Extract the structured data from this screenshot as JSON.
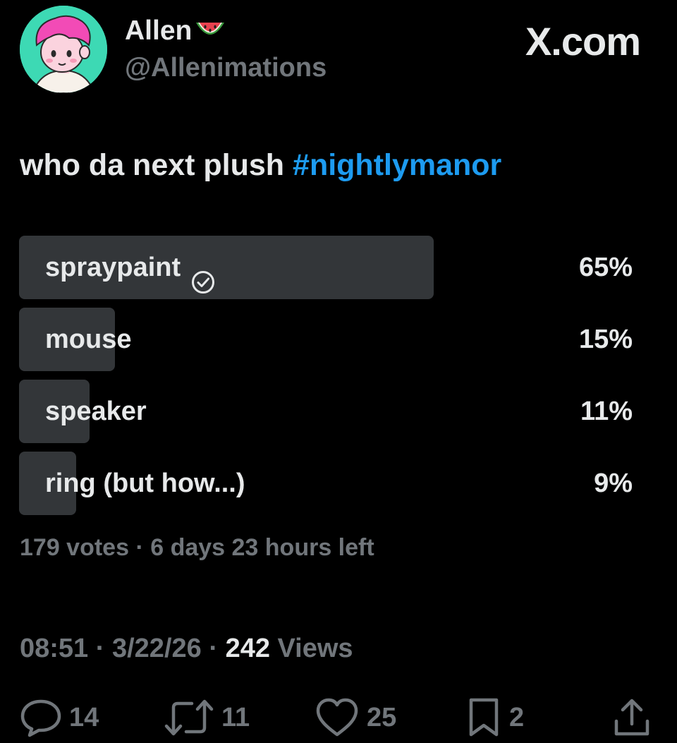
{
  "author": {
    "display_name": "Allen",
    "handle": "@Allenimations"
  },
  "site_label": "X.com",
  "tweet": {
    "text": "who da next plush ",
    "hashtag": "#nightlymanor"
  },
  "poll": {
    "options": [
      {
        "label": "spraypaint",
        "percent_text": "65%",
        "share": 0.65,
        "selected": true
      },
      {
        "label": "mouse",
        "percent_text": "15%",
        "share": 0.15,
        "selected": false
      },
      {
        "label": "speaker",
        "percent_text": "11%",
        "share": 0.11,
        "selected": false
      },
      {
        "label": "ring (but how...)",
        "percent_text": "9%",
        "share": 0.09,
        "selected": false
      }
    ],
    "votes_text": "179 votes",
    "separator": " · ",
    "time_left": "6 days 23 hours left"
  },
  "meta": {
    "time": "08:51",
    "date": "3/22/26",
    "views_count": "242",
    "views_label": " Views",
    "separator": " · "
  },
  "actions": {
    "replies": "14",
    "reposts": "11",
    "likes": "25",
    "bookmarks": "2"
  },
  "icons": {
    "reply": "reply-icon",
    "repost": "repost-icon",
    "like": "heart-icon",
    "bookmark": "bookmark-icon",
    "share": "share-icon",
    "verified_choice": "check-circle-icon",
    "emoji": "watermelon-icon"
  },
  "colors": {
    "background": "#000000",
    "text_primary": "#e7e9ea",
    "text_secondary": "#71767b",
    "hashtag": "#1d9bf0",
    "poll_bar": "#333639",
    "avatar_bg": "#3dd9b4",
    "avatar_hair": "#f24bb6"
  }
}
